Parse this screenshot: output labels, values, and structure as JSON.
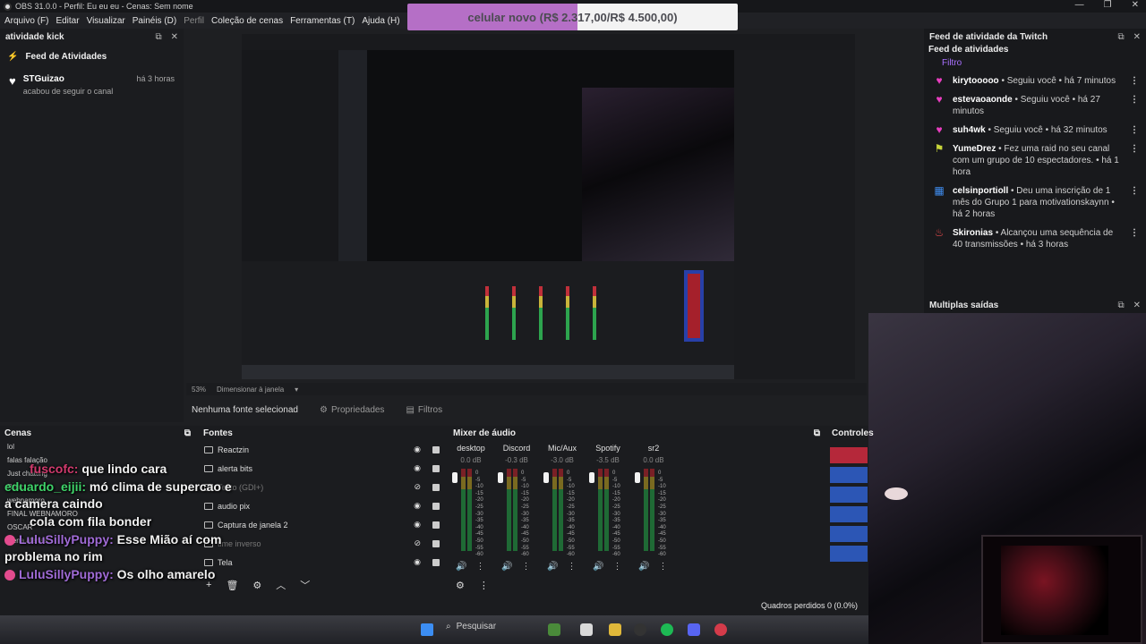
{
  "titlebar": {
    "text": "OBS 31.0.0 - Perfil: Eu eu eu - Cenas: Sem nome",
    "controls": [
      "—",
      "❐",
      "✕"
    ]
  },
  "menu": [
    "Arquivo (F)",
    "Editar",
    "Visualizar",
    "Painéis (D)",
    "Perfil",
    "Coleção de cenas",
    "Ferramentas (T)",
    "Ajuda (H)"
  ],
  "goal_banner": {
    "text": "celular novo (R$ 2.317,00/R$ 4.500,00)",
    "progress": 0.515
  },
  "kick_dock": {
    "title": "atividade kick",
    "feed_title": "Feed de Atividades",
    "items": [
      {
        "name": "STGuizao",
        "action": "acabou de seguir o canal",
        "time": "há 3 horas"
      }
    ]
  },
  "twitch_dock": {
    "title": "Feed de atividade da Twitch",
    "subtitle": "Feed de atividades",
    "filter": "Filtro",
    "items": [
      {
        "user": "kirytooooo",
        "text": "• Seguiu você • há 7 minutos",
        "icon": "heart-icon",
        "color": "#e93ec0"
      },
      {
        "user": "estevaoaonde",
        "text": "• Seguiu você • há 27 minutos",
        "icon": "heart-icon",
        "color": "#e93ec0"
      },
      {
        "user": "suh4wk",
        "text": "• Seguiu você • há 32 minutos",
        "icon": "heart-icon",
        "color": "#e93ec0"
      },
      {
        "user": "YumeDrez",
        "text": "• Fez uma raid no seu canal com um grupo de 10 espectadores. • há 1 hora",
        "icon": "raid-icon",
        "color": "#c7d43a"
      },
      {
        "user": "celsinportioll",
        "text": "• Deu uma inscrição de 1 mês do Grupo 1 para motivationskaynn • há 2 horas",
        "icon": "gift-icon",
        "color": "#3f8df0"
      },
      {
        "user": "Skironias",
        "text": "• Alcançou uma sequência de 40 transmissões • há 3 horas",
        "icon": "streak-icon",
        "color": "#e64b4b"
      }
    ]
  },
  "multi_dock": {
    "title": "Multiplas saídas"
  },
  "preview_status": {
    "zoom": "53%",
    "mode": "Dimensionar à janela"
  },
  "toolbar": {
    "no_source": "Nenhuma fonte selecionad",
    "properties": "Propriedades",
    "filters": "Filtros"
  },
  "scenes": {
    "title": "Cenas",
    "items": [
      "lol",
      "falas falação",
      "Just chatting",
      "React",
      "webnamoro",
      "FINAL WEBNAMORO",
      "OSCAR",
      "Cena alertas"
    ]
  },
  "sources": {
    "title": "Fontes",
    "items": [
      {
        "name": "Reactzin",
        "visible": true
      },
      {
        "name": "alerta bits",
        "visible": true
      },
      {
        "name": "Texto (GDI+)",
        "visible": false
      },
      {
        "name": "audio pix",
        "visible": true
      },
      {
        "name": "Captura de janela 2",
        "visible": true
      },
      {
        "name": "time inverso",
        "visible": false
      },
      {
        "name": "Tela",
        "visible": true
      }
    ]
  },
  "mixer": {
    "title": "Mixer de áudio",
    "channels": [
      {
        "name": "desktop",
        "db": "0.0 dB"
      },
      {
        "name": "Discord",
        "db": "-0.3 dB"
      },
      {
        "name": "Mic/Aux",
        "db": "-3.0 dB"
      },
      {
        "name": "Spotify",
        "db": "-3.5 dB"
      },
      {
        "name": "sr2",
        "db": "0.0 dB"
      }
    ],
    "ticks": [
      "0",
      "-5",
      "-10",
      "-15",
      "-20",
      "-25",
      "-30",
      "-35",
      "-40",
      "-45",
      "-50",
      "-55",
      "-60"
    ]
  },
  "controls": {
    "title": "Controles"
  },
  "chat": [
    {
      "user": "fuscofc:",
      "msg": "que lindo cara",
      "cls": "u1"
    },
    {
      "user": "eduardo_eijii:",
      "msg": "mó clima de supercao e a camera caindo",
      "cls": "u2"
    },
    {
      "user": "",
      "msg": "cola com fila bonder",
      "cls": "u1"
    },
    {
      "user": "LuluSillyPuppy:",
      "msg": "Esse Mião aí com problema no rim",
      "cls": "u3"
    },
    {
      "user": "LuluSillyPuppy:",
      "msg": "Os olho amarelo",
      "cls": "u3"
    }
  ],
  "status": {
    "dropped": "Quadros perdidos 0 (0.0%)"
  },
  "taskbar": {
    "search": "Pesquisar"
  }
}
